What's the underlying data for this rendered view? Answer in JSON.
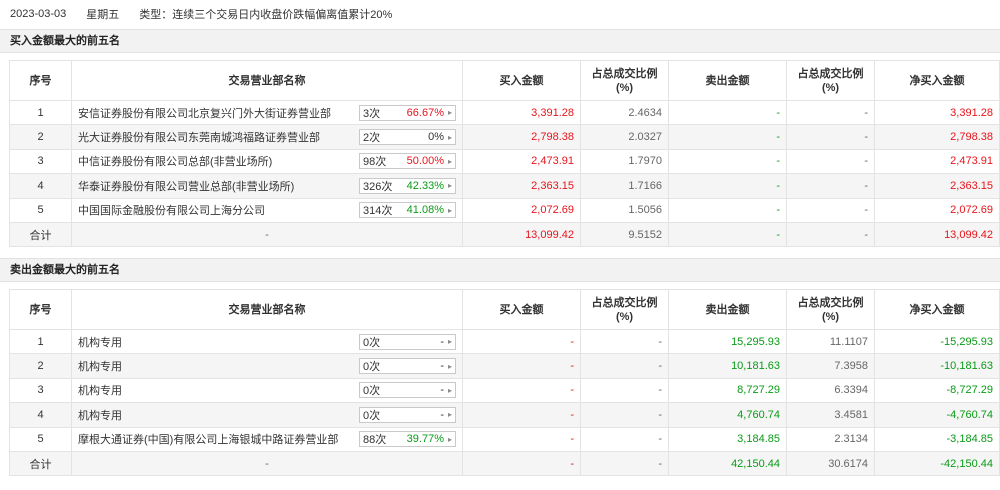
{
  "header": {
    "date": "2023-03-03",
    "weekday": "星期五",
    "type_label": "类型：",
    "type_value": "连续三个交易日内收盘价跌幅偏离值累计20%"
  },
  "buy_section": {
    "title": "买入金额最大的前五名",
    "columns": [
      "序号",
      "交易营业部名称",
      "买入金额",
      "占总成交比例\n(%)",
      "卖出金额",
      "占总成交比例\n(%)",
      "净买入金额"
    ],
    "rows": [
      {
        "no": "1",
        "name": "安信证券股份有限公司北京复兴门外大街证券营业部",
        "times": "3次",
        "rate": "66.67%",
        "buy": "3,391.28",
        "buy_pct": "2.4634",
        "sell": "-",
        "sell_pct": "-",
        "net": "3,391.28"
      },
      {
        "no": "2",
        "name": "光大证券股份有限公司东莞南城鸿福路证券营业部",
        "times": "2次",
        "rate": "0%",
        "buy": "2,798.38",
        "buy_pct": "2.0327",
        "sell": "-",
        "sell_pct": "-",
        "net": "2,798.38"
      },
      {
        "no": "3",
        "name": "中信证券股份有限公司总部(非营业场所)",
        "times": "98次",
        "rate": "50.00%",
        "buy": "2,473.91",
        "buy_pct": "1.7970",
        "sell": "-",
        "sell_pct": "-",
        "net": "2,473.91"
      },
      {
        "no": "4",
        "name": "华泰证券股份有限公司营业总部(非营业场所)",
        "times": "326次",
        "rate": "42.33%",
        "buy": "2,363.15",
        "buy_pct": "1.7166",
        "sell": "-",
        "sell_pct": "-",
        "net": "2,363.15"
      },
      {
        "no": "5",
        "name": "中国国际金融股份有限公司上海分公司",
        "times": "314次",
        "rate": "41.08%",
        "buy": "2,072.69",
        "buy_pct": "1.5056",
        "sell": "-",
        "sell_pct": "-",
        "net": "2,072.69"
      }
    ],
    "total": {
      "label": "合计",
      "name": "-",
      "buy": "13,099.42",
      "buy_pct": "9.5152",
      "sell": "-",
      "sell_pct": "-",
      "net": "13,099.42"
    }
  },
  "sell_section": {
    "title": "卖出金额最大的前五名",
    "columns": [
      "序号",
      "交易营业部名称",
      "买入金额",
      "占总成交比例\n(%)",
      "卖出金额",
      "占总成交比例\n(%)",
      "净买入金额"
    ],
    "rows": [
      {
        "no": "1",
        "name": "机构专用",
        "times": "0次",
        "rate": "-",
        "buy": "-",
        "buy_pct": "-",
        "sell": "15,295.93",
        "sell_pct": "11.1107",
        "net": "-15,295.93"
      },
      {
        "no": "2",
        "name": "机构专用",
        "times": "0次",
        "rate": "-",
        "buy": "-",
        "buy_pct": "-",
        "sell": "10,181.63",
        "sell_pct": "7.3958",
        "net": "-10,181.63"
      },
      {
        "no": "3",
        "name": "机构专用",
        "times": "0次",
        "rate": "-",
        "buy": "-",
        "buy_pct": "-",
        "sell": "8,727.29",
        "sell_pct": "6.3394",
        "net": "-8,727.29"
      },
      {
        "no": "4",
        "name": "机构专用",
        "times": "0次",
        "rate": "-",
        "buy": "-",
        "buy_pct": "-",
        "sell": "4,760.74",
        "sell_pct": "3.4581",
        "net": "-4,760.74"
      },
      {
        "no": "5",
        "name": "摩根大通证券(中国)有限公司上海银城中路证券营业部",
        "times": "88次",
        "rate": "39.77%",
        "buy": "-",
        "buy_pct": "-",
        "sell": "3,184.85",
        "sell_pct": "2.3134",
        "net": "-3,184.85"
      }
    ],
    "total": {
      "label": "合计",
      "name": "-",
      "buy": "-",
      "buy_pct": "-",
      "sell": "42,150.44",
      "sell_pct": "30.6174",
      "net": "-42,150.44"
    }
  },
  "colors": {
    "positive": "#e8141c",
    "negative": "#0a9b17"
  },
  "icons": {
    "dropdown": "chevron-right-icon"
  }
}
